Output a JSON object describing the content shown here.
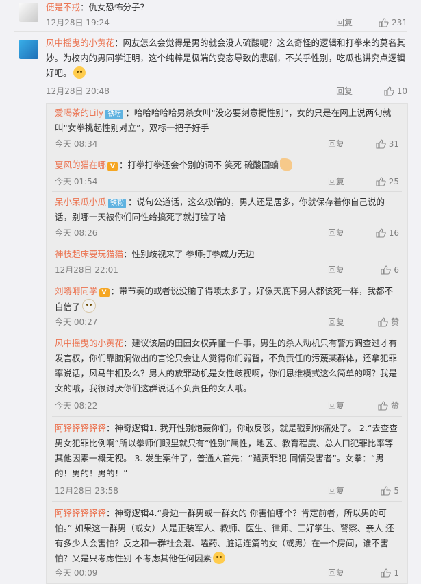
{
  "top": [
    {
      "user": "便是不戒",
      "text": "：仇女恐怖分子？",
      "time": "12月28日 19:24",
      "reply": "回复",
      "likes": "231"
    },
    {
      "user": "风中摇曳的小黄花",
      "text": "：网友怎么会觉得是男的就会没人硫酸呢？这么奇怪的逻辑和打拳来的莫名其妙。为校内的男同学证明，这个纯粹是极端的变态导致的悲剧，不关乎性别，吃瓜也讲究点逻辑好吧。",
      "time": "12月28日 20:48",
      "reply": "回复",
      "likes": "10"
    }
  ],
  "replies": [
    {
      "user": "爱喝茶的Lily",
      "badge": "铁粉",
      "text": "：哈哈哈哈哈男杀女叫“没必要刻意提性别”，女的只是在网上说两句就叫“女拳挑起性别对立”，双标一把子好手",
      "time": "今天 08:34",
      "reply": "回复",
      "likes": "31"
    },
    {
      "user": "夏风的猫在哪",
      "text": "：打拳打拳还会个别的词不 笑死 硫酸国蝻",
      "time": "今天 01:54",
      "reply": "回复",
      "likes": "25"
    },
    {
      "user": "呆小呆瓜小瓜",
      "badge": "铁粉",
      "text": "：说句公道话，这么极端的，男人还是居多，你就保存着你自己说的话，别哪一天被你们同性给搞死了就打脸了哈",
      "time": "今天 08:26",
      "reply": "回复",
      "likes": "16"
    },
    {
      "user": "神枝起床要玩猫猫",
      "text": "：性别歧视来了 拳师打拳威力无边",
      "time": "12月28日 22:01",
      "reply": "回复",
      "likes": "6"
    },
    {
      "user": "刘嘚嘚同学",
      "text": "：带节奏的或者说没脑子得喷太多了，好像天底下男人都该死一样，我都不自信了",
      "time": "今天 00:27",
      "reply": "回复",
      "likes": "赞"
    },
    {
      "user": "风中摇曳的小黄花",
      "text": "：建议该层的田园女权弄懂一件事，男生的杀人动机只有警方调查过才有发言权，你们靠脑洞做出的言论只会让人觉得你们弱智，不负责任的污蔑某群体，还拿犯罪率说话，风马牛相及么？男人的放罪动机是女性歧视啊，你们思维模式这么简单的啊？我是女的哦，我很讨厌你们这群说话不负责任的女人哦。",
      "time": "今天 08:22",
      "reply": "回复",
      "likes": "赞"
    },
    {
      "user": "阿铎铎铎铎铎",
      "text": "：神奇逻辑1. 我开性别炮轰你们，你敢反驳，就是戳到你痛处了。 2.“去查查男女犯罪比例啊”所以拳师们眼里就只有“性别”属性，地区、教育程度、总人口犯罪比率等其他因素一概无视。 3. 发生案件了，普通人首先：“谴责罪犯 同情受害者”。女拳：“男的！男的！男的！”",
      "time": "12月28日 23:58",
      "reply": "回复",
      "likes": "5"
    },
    {
      "user": "阿铎铎铎铎铎",
      "text": "：神奇逻辑4.“身边一群男或一群女的 你害怕哪个？肯定前者，所以男的可怕。” 如果这一群男（或女）人是正装军人、教师、医生、律师、三好学生、警察、亲人 还有多少人会害怕？反之和一群社会混、嗑药、脏话连篇的女（或男）在一个房间，谁不害怕？又是只考虑性别 不考虑其他任何因素",
      "time": "今天 00:09",
      "reply": "回复",
      "likes": "1"
    }
  ]
}
